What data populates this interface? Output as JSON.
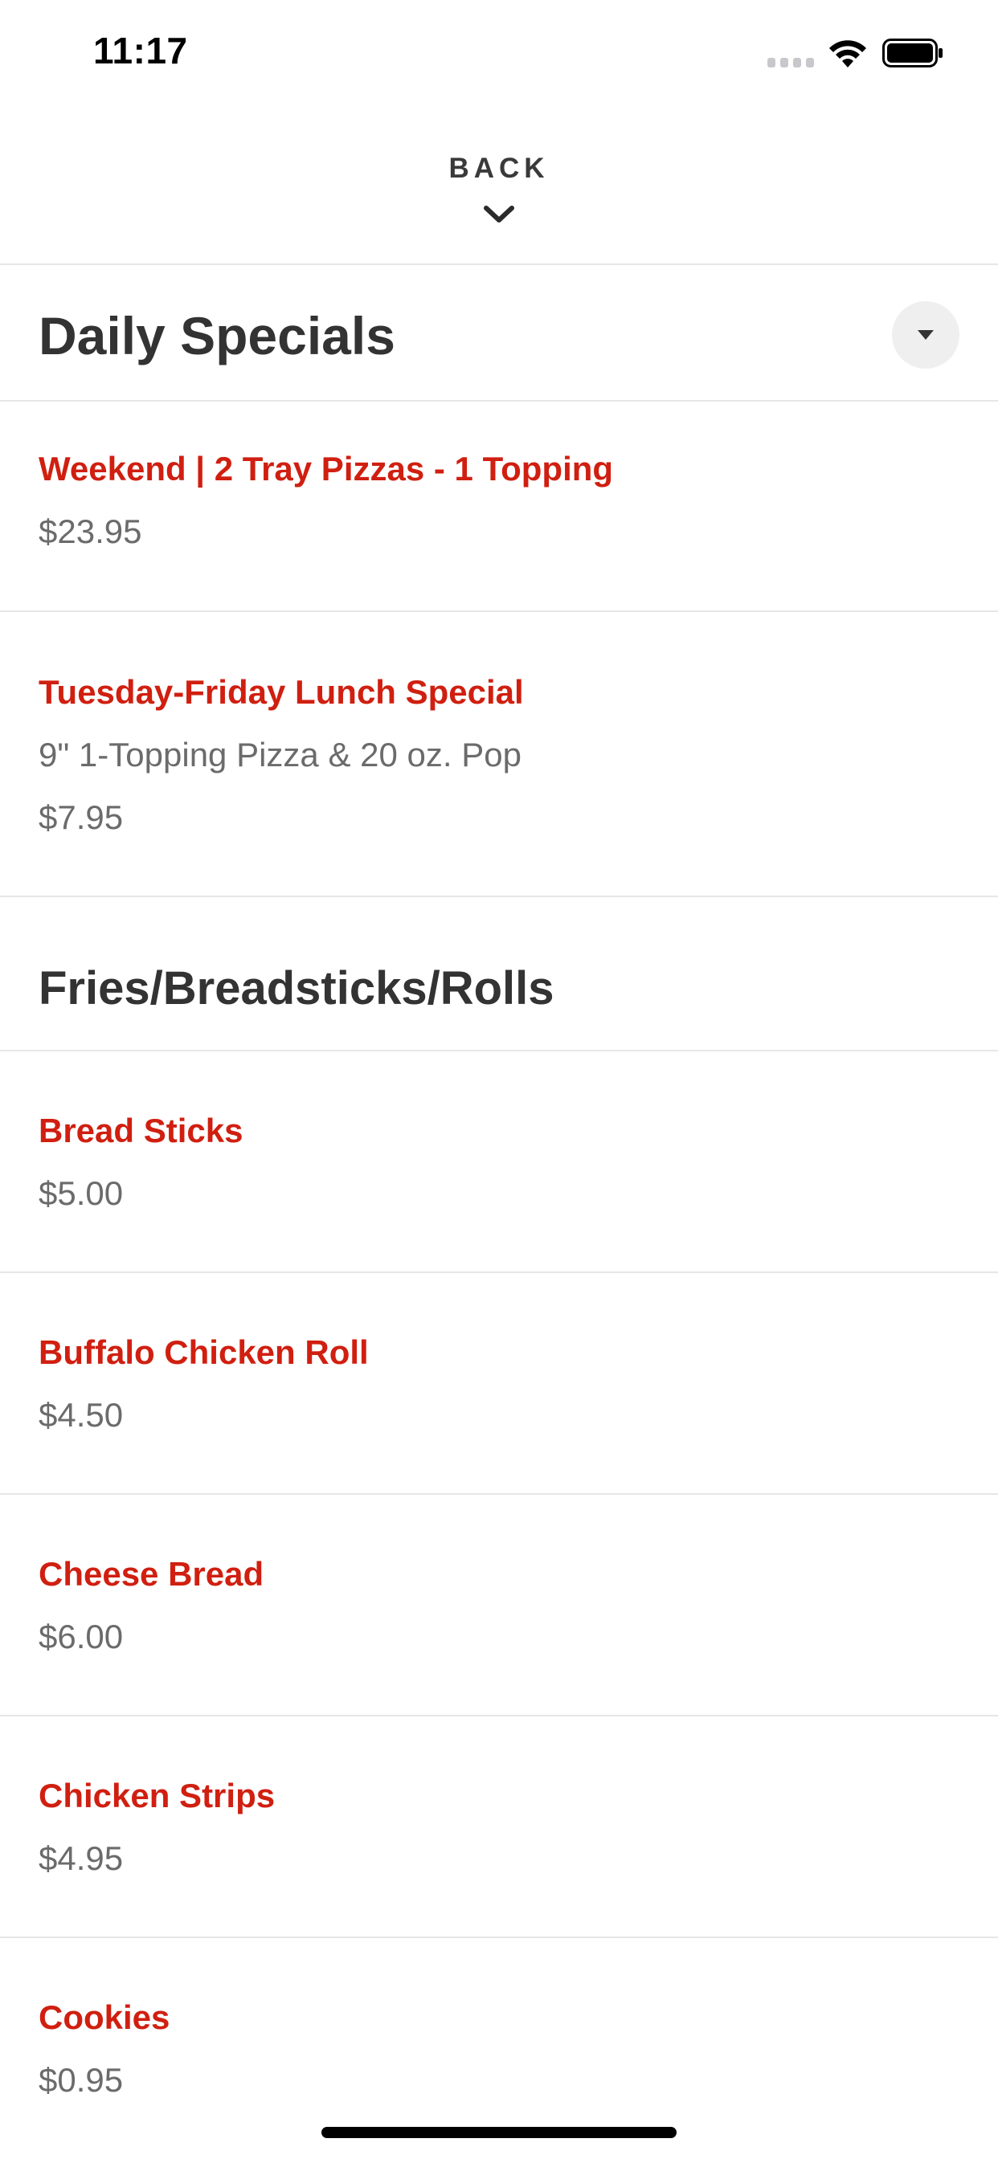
{
  "status_bar": {
    "time": "11:17",
    "icons": [
      "cellular-signal-icon",
      "wifi-icon",
      "battery-icon"
    ]
  },
  "header": {
    "back_label": "BACK",
    "back_icon": "chevron-down-icon"
  },
  "sections": [
    {
      "title": "Daily Specials",
      "toggle_icon": "caret-down-icon",
      "items": [
        {
          "name": "Weekend | 2 Tray Pizzas - 1 Topping",
          "description": "",
          "price": "$23.95"
        },
        {
          "name": "Tuesday-Friday Lunch Special",
          "description": "9\" 1-Topping Pizza & 20 oz. Pop",
          "price": "$7.95"
        }
      ]
    },
    {
      "title": "Fries/Breadsticks/Rolls",
      "items": [
        {
          "name": "Bread Sticks",
          "description": "",
          "price": "$5.00"
        },
        {
          "name": "Buffalo Chicken Roll",
          "description": "",
          "price": "$4.50"
        },
        {
          "name": "Cheese Bread",
          "description": "",
          "price": "$6.00"
        },
        {
          "name": "Chicken Strips",
          "description": "",
          "price": "$4.95"
        },
        {
          "name": "Cookies",
          "description": "",
          "price": "$0.95"
        }
      ]
    }
  ],
  "colors": {
    "item_name": "#d01f10",
    "secondary_text": "#6b6b6b",
    "heading_text": "#333333",
    "divider": "#e6e6e6"
  }
}
